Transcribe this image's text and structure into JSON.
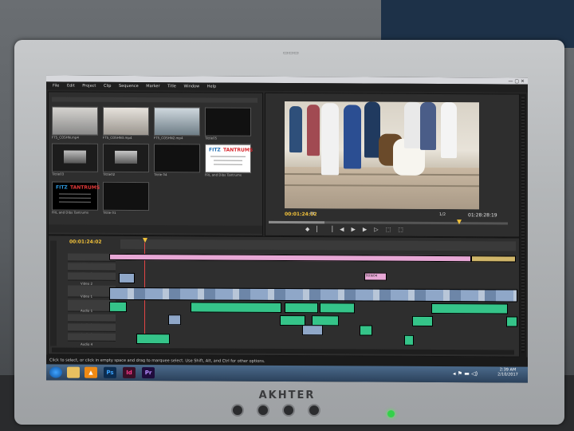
{
  "monitor": {
    "brand": "AKHTER"
  },
  "app": {
    "menu": [
      "File",
      "Edit",
      "Project",
      "Clip",
      "Sequence",
      "Marker",
      "Title",
      "Window",
      "Help"
    ]
  },
  "project_bin": {
    "clips": [
      {
        "name": "FTS_COSHN.mp4",
        "duration": "3:04"
      },
      {
        "name": "FTS_COSHN3.mp4",
        "duration": "3:04"
      },
      {
        "name": "FTS_COSHN2.mp4",
        "duration": "3:09"
      },
      {
        "name": "Tittle05",
        "duration": "3:09"
      },
      {
        "name": "Tittle03",
        "duration": "3:06"
      },
      {
        "name": "Tittle02",
        "duration": "3:06"
      },
      {
        "name": "Tittle 04",
        "duration": "4:00"
      },
      {
        "name": "FRL and Dibs Tantrums",
        "duration": "0:00"
      },
      {
        "name": "FRL and Dibs Tantrums",
        "duration": "3:04"
      },
      {
        "name": "Tittle 01",
        "duration": "3:06"
      }
    ],
    "title_card": {
      "line1": "FITZ",
      "line2": "TANTRUMS"
    }
  },
  "program_monitor": {
    "timecode_current": "00:01:24:02",
    "timecode_duration": "01:28:28:19",
    "zoom": "Fit",
    "quality": "1/2"
  },
  "timeline": {
    "sequence_timecode": "00:01:24:02",
    "tracks": [
      "Video 4",
      "Video 3",
      "Video 2",
      "Video 1",
      "Audio 1",
      "Audio 2",
      "Audio 3",
      "Audio 4"
    ],
    "marker_label": "Tittle04"
  },
  "status_bar": {
    "hint": "Click to select, or click in empty space and drag to marquee select. Use Shift, Alt, and Ctrl for other options."
  },
  "taskbar": {
    "time": "2:39 AM",
    "date": "2/10/2017",
    "apps": [
      "Ps",
      "Id",
      "Pr"
    ]
  },
  "colors": {
    "video_clip": "#8fa7c8",
    "audio_clip": "#35c489",
    "timecode": "#f2c23a",
    "pink_clip": "#e8a8d6"
  }
}
